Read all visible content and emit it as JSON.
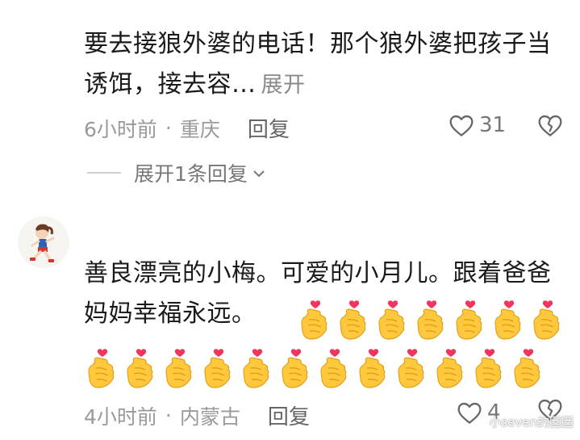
{
  "comment1": {
    "text": "要去接狼外婆的电话！那个狼外婆把孩子当诱饵，接去容…",
    "expand_label": "展开",
    "time": "6小时前",
    "separator": "·",
    "location": "重庆",
    "reply_label": "回复",
    "like_count": "31"
  },
  "thread": {
    "expand_replies_label": "展开1条回复",
    "chevron_icon": "chevron-down-icon"
  },
  "comment2": {
    "text": "善良漂亮的小梅。可爱的小月儿。跟着爸爸妈妈幸福永远。",
    "emoji_name": "finger-heart-emoji",
    "emoji_count": 19,
    "time": "4小时前",
    "separator": "·",
    "location": "内蒙古",
    "reply_label": "回复",
    "like_count": "4"
  },
  "watermark": "小seven的囡囡",
  "colors": {
    "text": "#1a1a1a",
    "meta": "#9a9a9a",
    "emoji_yellow": "#FFC83D",
    "heart_red": "#F0355E"
  }
}
